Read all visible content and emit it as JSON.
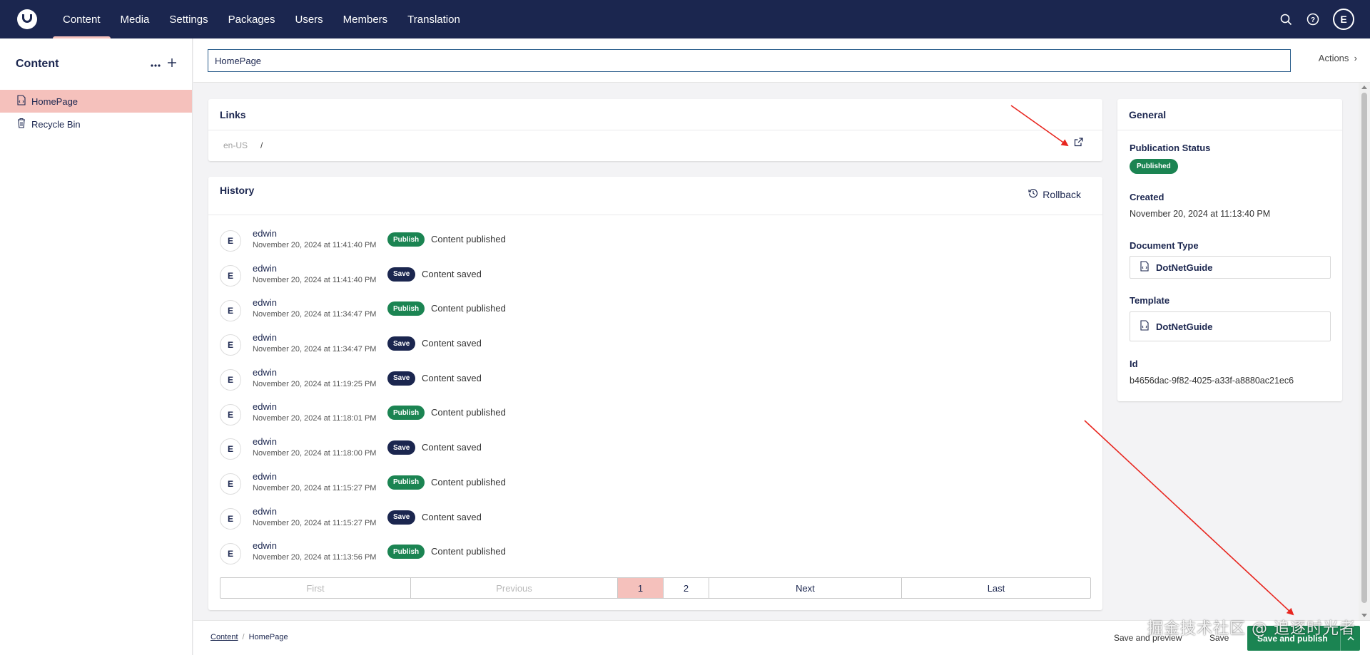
{
  "nav": {
    "items": [
      {
        "label": "Content",
        "active": true
      },
      {
        "label": "Media",
        "active": false
      },
      {
        "label": "Settings",
        "active": false
      },
      {
        "label": "Packages",
        "active": false
      },
      {
        "label": "Users",
        "active": false
      },
      {
        "label": "Members",
        "active": false
      },
      {
        "label": "Translation",
        "active": false
      }
    ],
    "user_initial": "E"
  },
  "sidebar": {
    "title": "Content",
    "more_icon": "ellipsis-icon",
    "add_icon": "plus-icon",
    "items": [
      {
        "label": "HomePage",
        "icon": "document-icon",
        "active": true
      },
      {
        "label": "Recycle Bin",
        "icon": "trash-icon",
        "active": false
      }
    ]
  },
  "editor": {
    "name_value": "HomePage",
    "actions_label": "Actions"
  },
  "links": {
    "title": "Links",
    "culture": "en-US",
    "url": "/"
  },
  "history": {
    "title": "History",
    "rollback_label": "Rollback",
    "entries": [
      {
        "initial": "E",
        "user": "edwin",
        "date": "November 20, 2024 at 11:41:40 PM",
        "badge": "Publish",
        "text": "Content published"
      },
      {
        "initial": "E",
        "user": "edwin",
        "date": "November 20, 2024 at 11:41:40 PM",
        "badge": "Save",
        "text": "Content saved"
      },
      {
        "initial": "E",
        "user": "edwin",
        "date": "November 20, 2024 at 11:34:47 PM",
        "badge": "Publish",
        "text": "Content published"
      },
      {
        "initial": "E",
        "user": "edwin",
        "date": "November 20, 2024 at 11:34:47 PM",
        "badge": "Save",
        "text": "Content saved"
      },
      {
        "initial": "E",
        "user": "edwin",
        "date": "November 20, 2024 at 11:19:25 PM",
        "badge": "Save",
        "text": "Content saved"
      },
      {
        "initial": "E",
        "user": "edwin",
        "date": "November 20, 2024 at 11:18:01 PM",
        "badge": "Publish",
        "text": "Content published"
      },
      {
        "initial": "E",
        "user": "edwin",
        "date": "November 20, 2024 at 11:18:00 PM",
        "badge": "Save",
        "text": "Content saved"
      },
      {
        "initial": "E",
        "user": "edwin",
        "date": "November 20, 2024 at 11:15:27 PM",
        "badge": "Publish",
        "text": "Content published"
      },
      {
        "initial": "E",
        "user": "edwin",
        "date": "November 20, 2024 at 11:15:27 PM",
        "badge": "Save",
        "text": "Content saved"
      },
      {
        "initial": "E",
        "user": "edwin",
        "date": "November 20, 2024 at 11:13:56 PM",
        "badge": "Publish",
        "text": "Content published"
      }
    ],
    "pagination": {
      "first": "First",
      "previous": "Previous",
      "pages": [
        "1",
        "2"
      ],
      "current_page": "1",
      "next": "Next",
      "last": "Last"
    }
  },
  "general": {
    "title": "General",
    "publication_status_label": "Publication Status",
    "publication_status": "Published",
    "created_label": "Created",
    "created": "November 20, 2024 at 11:13:40 PM",
    "document_type_label": "Document Type",
    "document_type": "DotNetGuide",
    "template_label": "Template",
    "template": "DotNetGuide",
    "id_label": "Id",
    "id": "b4656dac-9f82-4025-a33f-a8880ac21ec6"
  },
  "footer": {
    "breadcrumb": [
      "Content",
      "HomePage"
    ],
    "save_and_preview": "Save and preview",
    "save": "Save",
    "save_and_publish": "Save and publish"
  },
  "watermark": "掘金技术社区 @ 追逐时光者",
  "colors": {
    "topbar": "#1b264f",
    "active_highlight": "#f5c1bc",
    "publish_green": "#1b8452",
    "save_navy": "#1b264f",
    "annotation_red": "#e8261f"
  }
}
